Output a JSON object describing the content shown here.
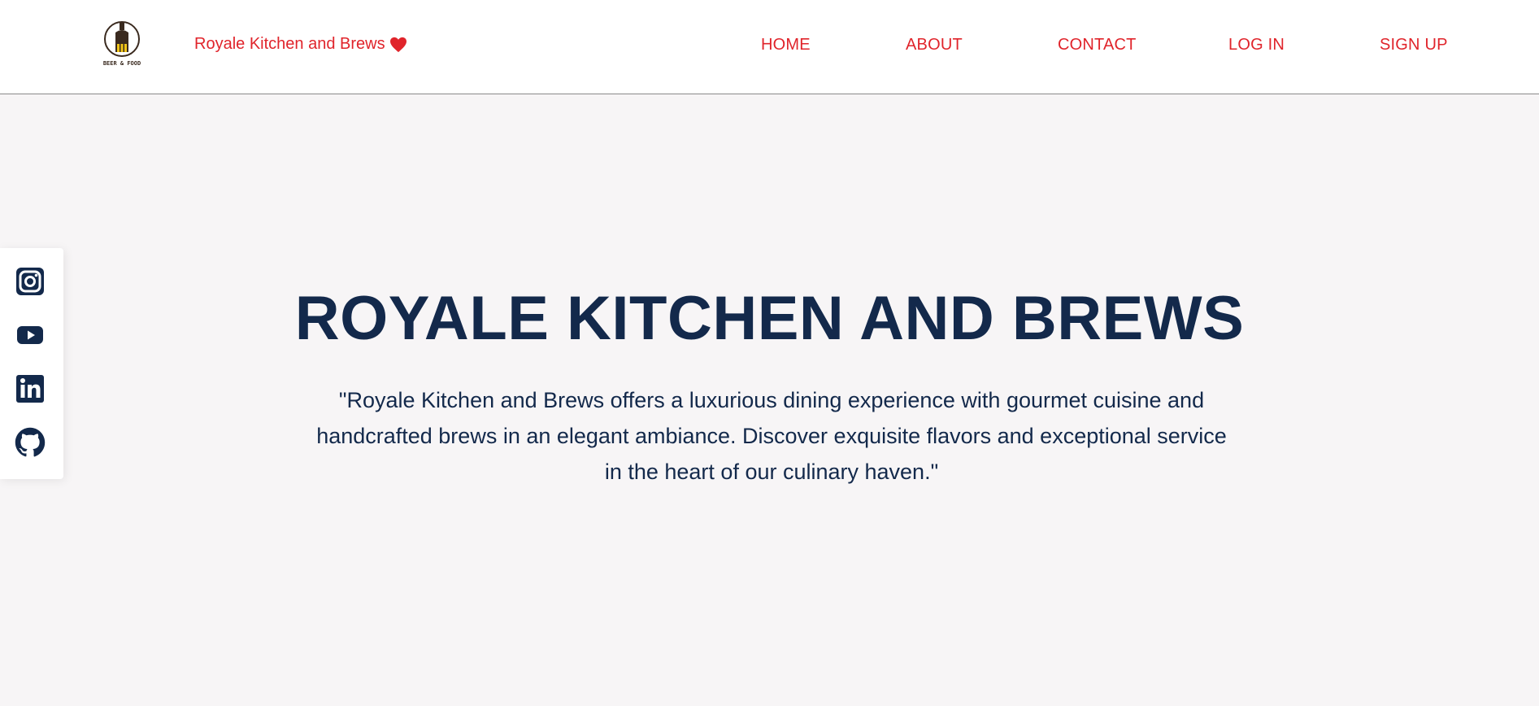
{
  "header": {
    "logo_text": "BEER & FOOD",
    "brand": "Royale Kitchen and Brews",
    "brand_icon": "heart-icon",
    "nav": {
      "home": "HOME",
      "about": "ABOUT",
      "contact": "CONTACT",
      "login": "LOG IN",
      "signup": "SIGN UP"
    }
  },
  "social": {
    "icons": [
      "instagram-icon",
      "youtube-icon",
      "linkedin-icon",
      "github-icon"
    ]
  },
  "hero": {
    "title": "ROYALE KITCHEN AND BREWS",
    "description": "\"Royale Kitchen and Brews offers a luxurious dining experience with gourmet cuisine and handcrafted brews in an elegant ambiance. Discover exquisite flavors and exceptional service in the heart of our culinary haven.\""
  },
  "colors": {
    "accent": "#e0242b",
    "heading": "#13294b",
    "background": "#f7f5f6",
    "header_bg": "#ffffff"
  }
}
